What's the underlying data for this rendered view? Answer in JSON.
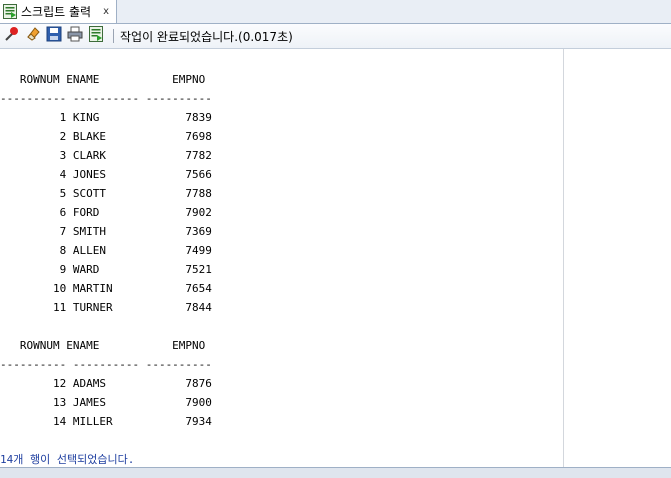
{
  "tab": {
    "label": "스크립트 출력",
    "close": "x"
  },
  "toolbar": {
    "status": "작업이 완료되었습니다.(0.017초)"
  },
  "output": {
    "header": "   ROWNUM ENAME           EMPNO",
    "separator": "---------- ---------- ----------",
    "rows_page1": [
      "         1 KING             7839",
      "         2 BLAKE            7698",
      "         3 CLARK            7782",
      "         4 JONES            7566",
      "         5 SCOTT            7788",
      "         6 FORD             7902",
      "         7 SMITH            7369",
      "         8 ALLEN            7499",
      "         9 WARD             7521",
      "        10 MARTIN           7654",
      "        11 TURNER           7844"
    ],
    "rows_page2": [
      "        12 ADAMS            7876",
      "        13 JAMES            7900",
      "        14 MILLER           7934"
    ],
    "footer": "14개 행이 선택되었습니다."
  },
  "colors": {
    "footer_text": "#1f3fa0"
  }
}
